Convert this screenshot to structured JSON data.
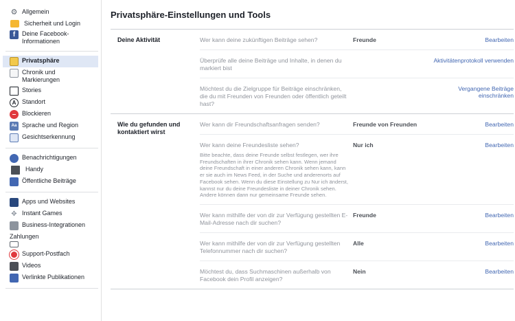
{
  "sidebar": {
    "groups": [
      [
        {
          "label": "Allgemein",
          "icon": "gear-icon"
        },
        {
          "label": "Sicherheit und Login",
          "icon": "lock-icon"
        },
        {
          "label": "Deine Facebook-Informationen",
          "icon": "facebook-icon"
        }
      ],
      [
        {
          "label": "Privatsphäre",
          "icon": "privacy-lock-icon",
          "active": true
        },
        {
          "label": "Chronik und Markierungen",
          "icon": "timeline-icon"
        },
        {
          "label": "Stories",
          "icon": "book-icon"
        },
        {
          "label": "Standort",
          "icon": "location-icon"
        },
        {
          "label": "Blockieren",
          "icon": "block-icon"
        },
        {
          "label": "Sprache und Region",
          "icon": "language-icon"
        },
        {
          "label": "Gesichtserkennung",
          "icon": "face-recognition-icon"
        }
      ],
      [
        {
          "label": "Benachrichtigungen",
          "icon": "globe-icon"
        },
        {
          "label": "Handy",
          "icon": "phone-icon"
        },
        {
          "label": "Öffentliche Beiträge",
          "icon": "rss-icon"
        }
      ],
      [
        {
          "label": "Apps und Websites",
          "icon": "apps-icon"
        },
        {
          "label": "Instant Games",
          "icon": "gamepad-icon"
        },
        {
          "label": "Business-Integrationen",
          "icon": "business-icon"
        },
        {
          "label": "Zahlungen",
          "icon": "card-icon"
        },
        {
          "label": "Support-Postfach",
          "icon": "lifebuoy-icon"
        },
        {
          "label": "Videos",
          "icon": "film-icon"
        },
        {
          "label": "Verlinkte Publikationen",
          "icon": "publications-icon"
        }
      ]
    ]
  },
  "main": {
    "title": "Privatsphäre-Einstellungen und Tools",
    "sections": [
      {
        "title": "Deine Aktivität",
        "rows": [
          {
            "question": "Wer kann deine zukünftigen Beiträge sehen?",
            "value": "Freunde",
            "action": "Bearbeiten"
          },
          {
            "question": "Überprüfe alle deine Beiträge und Inhalte, in denen du markiert bist",
            "value": "",
            "action": "Aktivitätenprotokoll verwenden"
          },
          {
            "question": "Möchtest du die Zielgruppe für Beiträge einschränken, die du mit Freunden von Freunden oder öffentlich geteilt hast?",
            "value": "",
            "action": "Vergangene Beiträge einschränken"
          }
        ]
      },
      {
        "title": "Wie du gefunden und kontaktiert wirst",
        "rows": [
          {
            "question": "Wer kann dir Freundschaftsanfragen senden?",
            "value": "Freunde von Freunden",
            "action": "Bearbeiten"
          },
          {
            "question": "Wer kann deine Freundesliste sehen?",
            "note": "Bitte beachte, dass deine Freunde selbst festlegen, wer ihre Freundschaften in ihrer Chronik sehen kann. Wenn jemand deine Freundschaft in einer anderen Chronik sehen kann, kann er sie auch im News Feed, in der Suche und anderenorts auf Facebook sehen. Wenn du diese Einstellung zu Nur ich änderst, kannst nur du deine Freundesliste in deiner Chronik sehen. Andere können dann nur gemeinsame Freunde sehen.",
            "value": "Nur ich",
            "action": "Bearbeiten"
          },
          {
            "question": "Wer kann mithilfe der von dir zur Verfügung gestellten E-Mail-Adresse nach dir suchen?",
            "value": "Freunde",
            "action": "Bearbeiten"
          },
          {
            "question": "Wer kann mithilfe der von dir zur Verfügung gestellten Telefonnummer nach dir suchen?",
            "value": "Alle",
            "action": "Bearbeiten"
          },
          {
            "question": "Möchtest du, dass Suchmaschinen außerhalb von Facebook dein Profil anzeigen?",
            "value": "Nein",
            "action": "Bearbeiten"
          }
        ]
      }
    ]
  }
}
